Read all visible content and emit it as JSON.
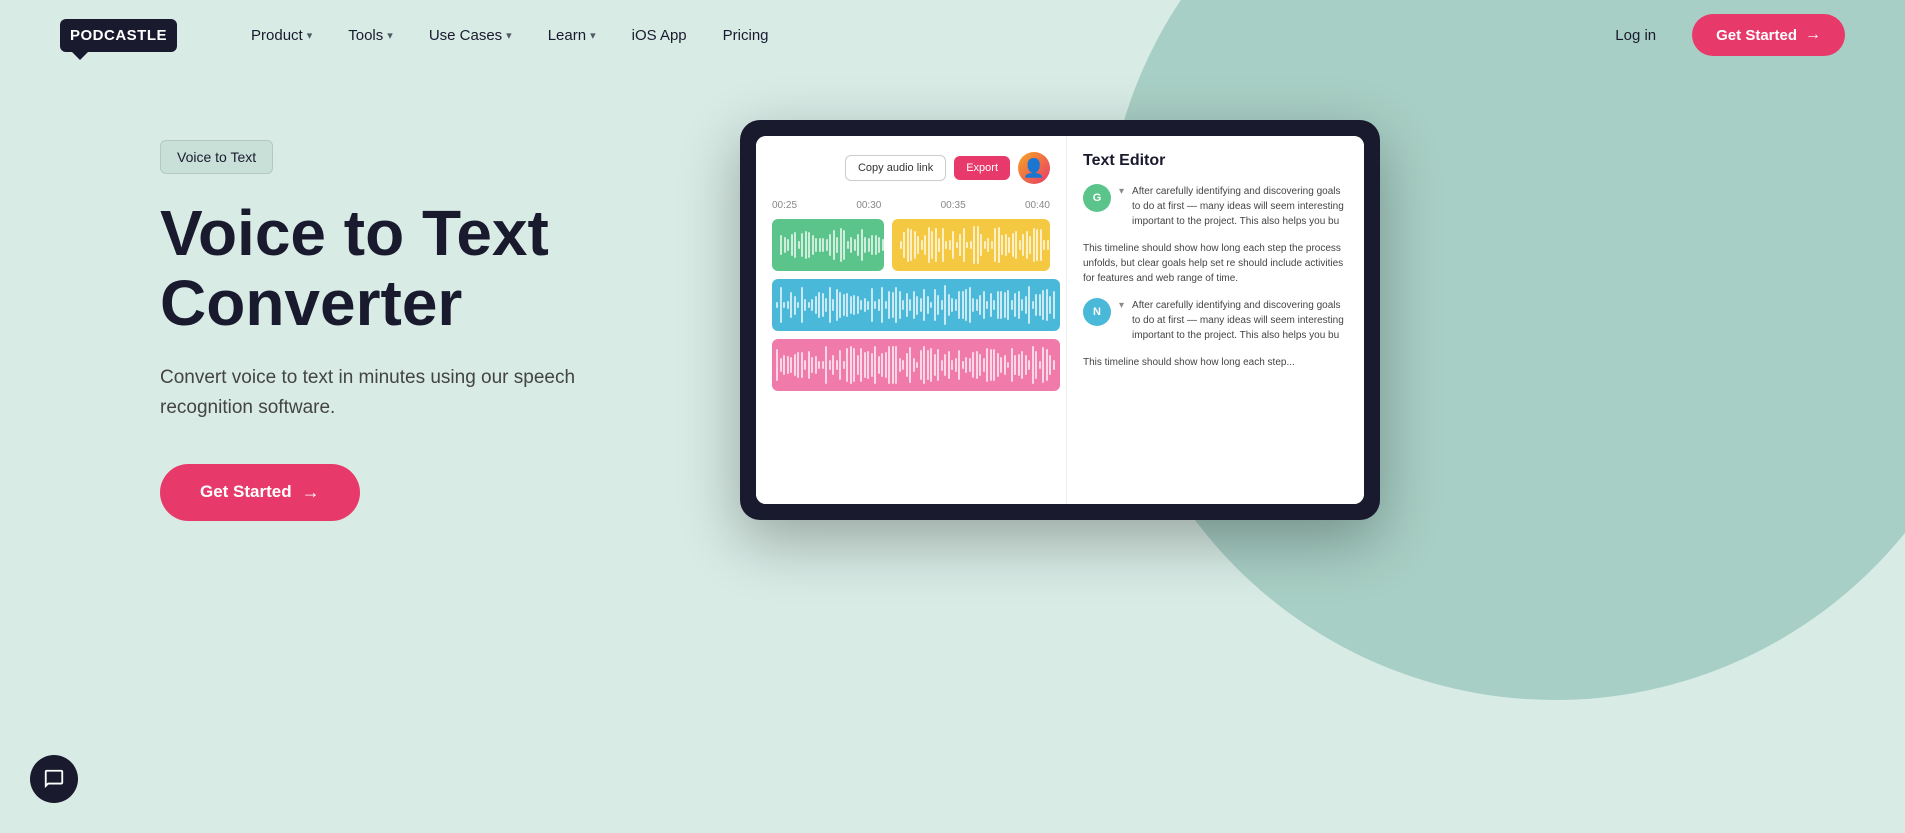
{
  "meta": {
    "title": "Podcastle - Voice to Text Converter"
  },
  "navbar": {
    "logo": "PODCASTLE",
    "nav_items": [
      {
        "label": "Product",
        "has_dropdown": true
      },
      {
        "label": "Tools",
        "has_dropdown": true
      },
      {
        "label": "Use Cases",
        "has_dropdown": true
      },
      {
        "label": "Learn",
        "has_dropdown": true
      },
      {
        "label": "iOS App",
        "has_dropdown": false
      },
      {
        "label": "Pricing",
        "has_dropdown": false
      }
    ],
    "login_label": "Log in",
    "get_started_label": "Get Started"
  },
  "hero": {
    "badge": "Voice to Text",
    "title_line1": "Voice to Text",
    "title_line2": "Converter",
    "subtitle": "Convert voice to text in minutes using our speech recognition software.",
    "cta_label": "Get Started"
  },
  "device": {
    "copy_link_label": "Copy audio link",
    "export_label": "Export",
    "timeline": {
      "t1": "00:25",
      "t2": "00:30",
      "t3": "00:35",
      "t4": "00:40"
    },
    "text_editor_title": "Text Editor",
    "comments": [
      {
        "avatar_letter": "G",
        "avatar_color": "green",
        "text": "After carefully identifying and discovering goals to do at first — many ideas will seem interesting important to the project. This also helps you bu"
      },
      {
        "avatar_letter": "",
        "avatar_color": "",
        "text": "This timeline should show how long each step the process unfolds, but clear goals help set re should include activities for features and web range of time."
      },
      {
        "avatar_letter": "N",
        "avatar_color": "teal",
        "text": "After carefully identifying and discovering goals to do at first — many ideas will seem interesting important to the project. This also helps you bu"
      },
      {
        "avatar_letter": "",
        "avatar_color": "",
        "text": "This timeline should show how long each step..."
      }
    ]
  },
  "chat": {
    "icon": "chat-icon"
  }
}
